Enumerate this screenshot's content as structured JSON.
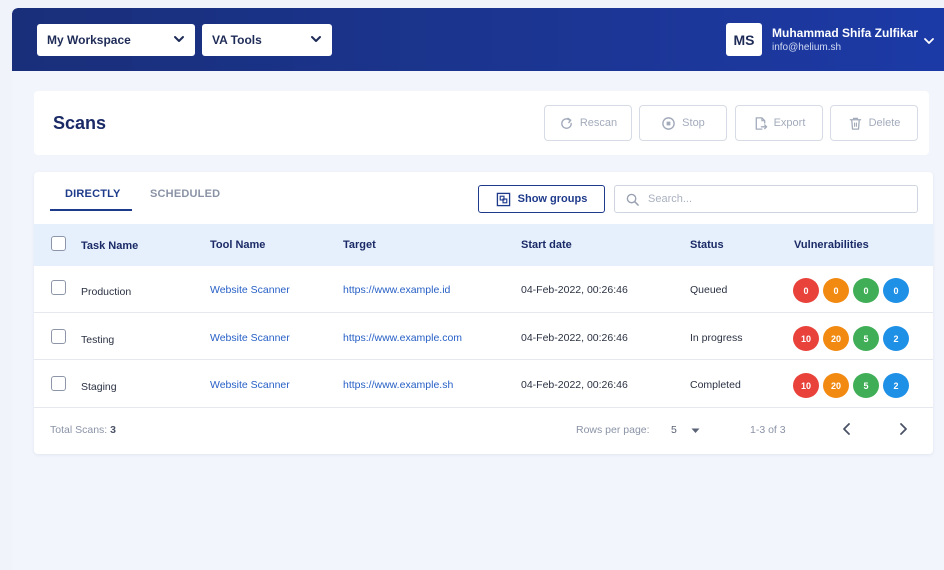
{
  "header": {
    "workspace_label": "My Workspace",
    "tools_label": "VA Tools",
    "user_initials": "MS",
    "user_name": "Muhammad Shifa Zulfikar",
    "user_email": "info@helium.sh"
  },
  "page": {
    "title": "Scans",
    "actions": {
      "rescan": "Rescan",
      "stop": "Stop",
      "export": "Export",
      "delete": "Delete"
    }
  },
  "tabs": {
    "directly": "DIRECTLY",
    "scheduled": "SCHEDULED"
  },
  "toolbar": {
    "show_groups": "Show groups",
    "search_placeholder": "Search..."
  },
  "table": {
    "columns": {
      "task_name": "Task Name",
      "tool_name": "Tool Name",
      "target": "Target",
      "start_date": "Start date",
      "status": "Status",
      "vulnerabilities": "Vulnerabilities"
    },
    "rows": [
      {
        "task": "Production",
        "tool": "Website Scanner",
        "target": "https://www.example.id",
        "start": "04-Feb-2022, 00:26:46",
        "status": "Queued",
        "vulns": [
          "0",
          "0",
          "0",
          "0"
        ]
      },
      {
        "task": "Testing",
        "tool": "Website Scanner",
        "target": "https://www.example.com",
        "start": "04-Feb-2022, 00:26:46",
        "status": "In progress",
        "vulns": [
          "10",
          "20",
          "5",
          "2"
        ]
      },
      {
        "task": "Staging",
        "tool": "Website Scanner",
        "target": "https://www.example.sh",
        "start": "04-Feb-2022, 00:26:46",
        "status": "Completed",
        "vulns": [
          "10",
          "20",
          "5",
          "2"
        ]
      }
    ],
    "severity_colors": {
      "critical": "#e8423b",
      "high": "#f28a12",
      "medium": "#3fae56",
      "low": "#1e90e6"
    }
  },
  "footer": {
    "total_label": "Total Scans:",
    "total_value": "3",
    "rows_per_page_label": "Rows per page:",
    "rows_per_page_value": "5",
    "range": "1-3 of 3"
  },
  "colors": {
    "brand_dark": "#1a2f7a",
    "brand_accent": "#1e3a8a",
    "link": "#2860c6"
  }
}
